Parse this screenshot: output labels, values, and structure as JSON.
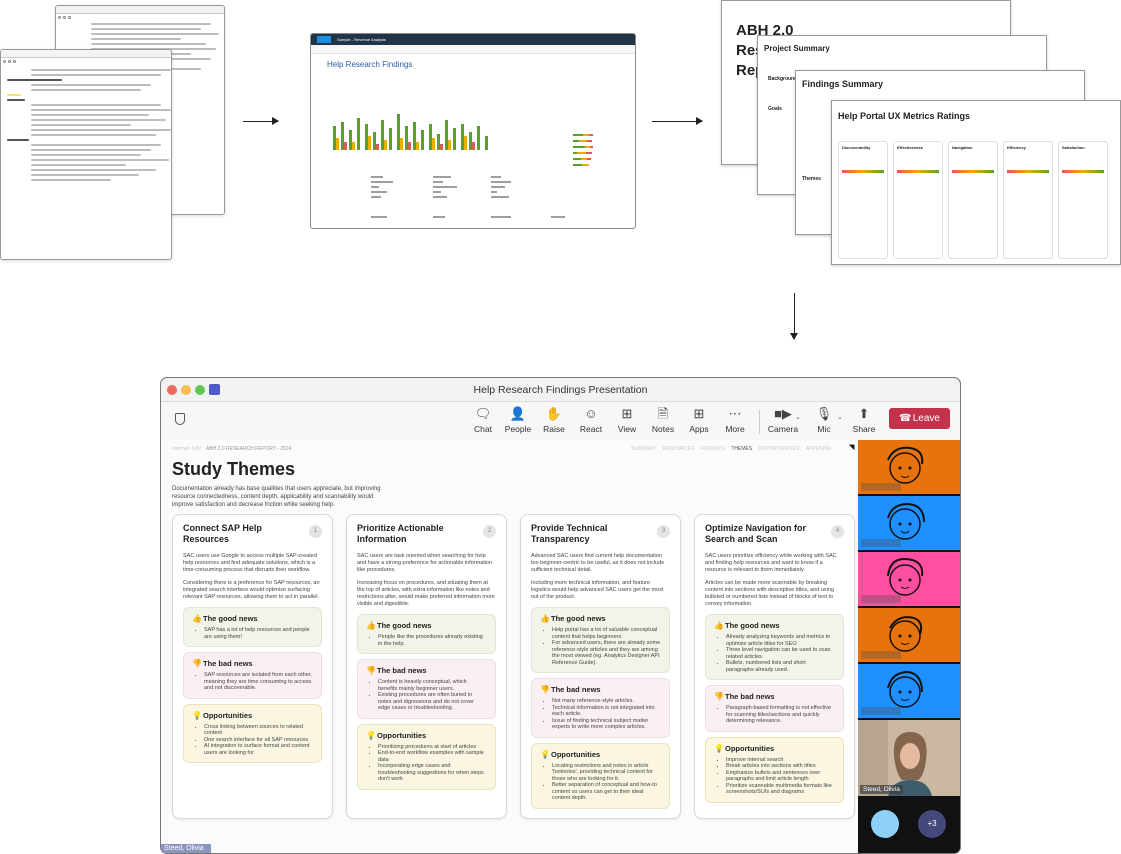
{
  "meeting": {
    "window_title": "Help Research Findings Presentation",
    "toolbar": {
      "chat": "Chat",
      "people": "People",
      "raise": "Raise",
      "react": "React",
      "view": "View",
      "notes": "Notes",
      "apps": "Apps",
      "more": "More",
      "camera": "Camera",
      "mic": "Mic",
      "share": "Share",
      "leave": "Leave"
    },
    "participants": {
      "self_name": "Steed, Olivia",
      "bottom_name": "Steed, Olivia",
      "overflow_count": "+3"
    },
    "colors": {
      "leave": "#c4314b",
      "tile_orange": "#e8730c",
      "tile_blue": "#1e90ff",
      "tile_pink": "#ff4fa0",
      "bubble_light": "#8ed0f7",
      "bubble_dark": "#44487a"
    }
  },
  "slide": {
    "breadcrumb_left": "Internal: SAP",
    "breadcrumb_report": "ABH 2.0 RESEARCH REPORT - 2024",
    "nav": [
      "SUMMARY",
      "RESOURCES",
      "FORMATS",
      "THEMES",
      "OPPORTUNITIES",
      "APPENDIX"
    ],
    "title": "Study Themes",
    "intro": "Documentation already has base qualities that users appreciate, but improving resource connectedness, content depth, applicability and scannability would improve satisfaction and decrease friction while seeking help.",
    "labels": {
      "good": "The good news",
      "bad": "The bad news",
      "opp": "Opportunities"
    },
    "cards": [
      {
        "title": "Connect SAP Help Resources",
        "number": "1",
        "desc1": "SAC users use Google to access multiple SAP-created help resources and find adequate solutions, which is a time-consuming process that disrupts their workflow.",
        "desc2": "Considering there is a preference for SAP resources, an integrated search interface would optimize surfacing relevant SAP resources, allowing them to act in parallel.",
        "good": [
          "SAP has a lot of help resources and people are using them!"
        ],
        "bad": [
          "SAP resources are isolated from each other, meaning they are time consuming to access and not discoverable."
        ],
        "opp": [
          "Cross linking between sources to related content",
          "One search interface for all SAP resources",
          "AI integration to surface format and content users are looking for"
        ]
      },
      {
        "title": "Prioritize Actionable Information",
        "number": "2",
        "desc1": "SAC users are task oriented when searching for help and have a strong preference for actionable information like procedures.",
        "desc2": "Increasing focus on procedures, and situating them at the top of articles, with extra information like notes and restrictions after, would make preferred information more visible and digestible.",
        "good": [
          "People like the procedures already existing in the help."
        ],
        "bad": [
          "Content is heavily conceptual, which benefits mainly beginner users.",
          "Existing procedures are often buried in notes and digressions and do not cover edge cases or troubleshooting."
        ],
        "opp": [
          "Prioritizing procedures at start of articles",
          "End-to-end workflow examples with sample data",
          "Incorporating edge cases and troubleshooting suggestions for when steps don't work"
        ]
      },
      {
        "title": "Provide Technical Transparency",
        "number": "3",
        "desc1": "Advanced SAC users find current help documentation too beginner-centric to be useful, as it does not include sufficient technical detail.",
        "desc2": "Including more technical information, and feature logistics would help advanced SAC users get the most out of the product.",
        "good": [
          "Help portal has a lot of valuable conceptual content that helps beginners.",
          "For advanced users, there are already some reference-style articles and they are among the most viewed (eg. Analytics Designer API Reference Guide)."
        ],
        "bad": [
          "Not many reference-style articles.",
          "Technical information is not integrated into each article.",
          "Issue of finding technical subject matter experts to write more complex articles."
        ],
        "opp": [
          "Locating restrictions and notes in article 'footnotes', providing technical content for those who are looking for it.",
          "Better separation of conceptual and how-to content so users can get to their ideal content depth."
        ]
      },
      {
        "title": "Optimize Navigation for Search and Scan",
        "number": "4",
        "desc1": "SAC users prioritize efficiency while working with SAC and finding help resources and want to know if a resource is relevant to them immediately.",
        "desc2": "Articles can be made more scannable by breaking content into sections with descriptive titles, and using bulleted or numbered lists instead of blocks of text to convey information.",
        "good": [
          "Already analyzing keywords and metrics to optimize article titles for SEO",
          "Three level navigation can be used to scan related articles.",
          "Bullets, numbered lists and short paragraphs already used."
        ],
        "bad": [
          "Paragraph-based formatting is not effective for scanning titles/sections and quickly determining relevance."
        ],
        "opp": [
          "Improve internal search",
          "Break articles into sections with titles",
          "Emphasize bullets and sentences over paragraphs and limit article length",
          "Prioritize scannable multimedia formats like screenshots/SUIs and diagrams"
        ]
      }
    ]
  },
  "workflow": {
    "sac_title": "Help Research Findings",
    "sac_story": "Sample - Revenue Analysis",
    "deck_title": "ABH 2.0 Research Report",
    "project_summary": "Project Summary",
    "findings_summary": "Findings Summary",
    "metrics_title": "Help Portal UX Metrics Ratings",
    "metric_columns": [
      "Discoverability",
      "Effectiveness",
      "Navigation",
      "Efficiency",
      "Satisfaction"
    ],
    "summary_sections": [
      "Background",
      "Goals",
      "Themes"
    ]
  }
}
